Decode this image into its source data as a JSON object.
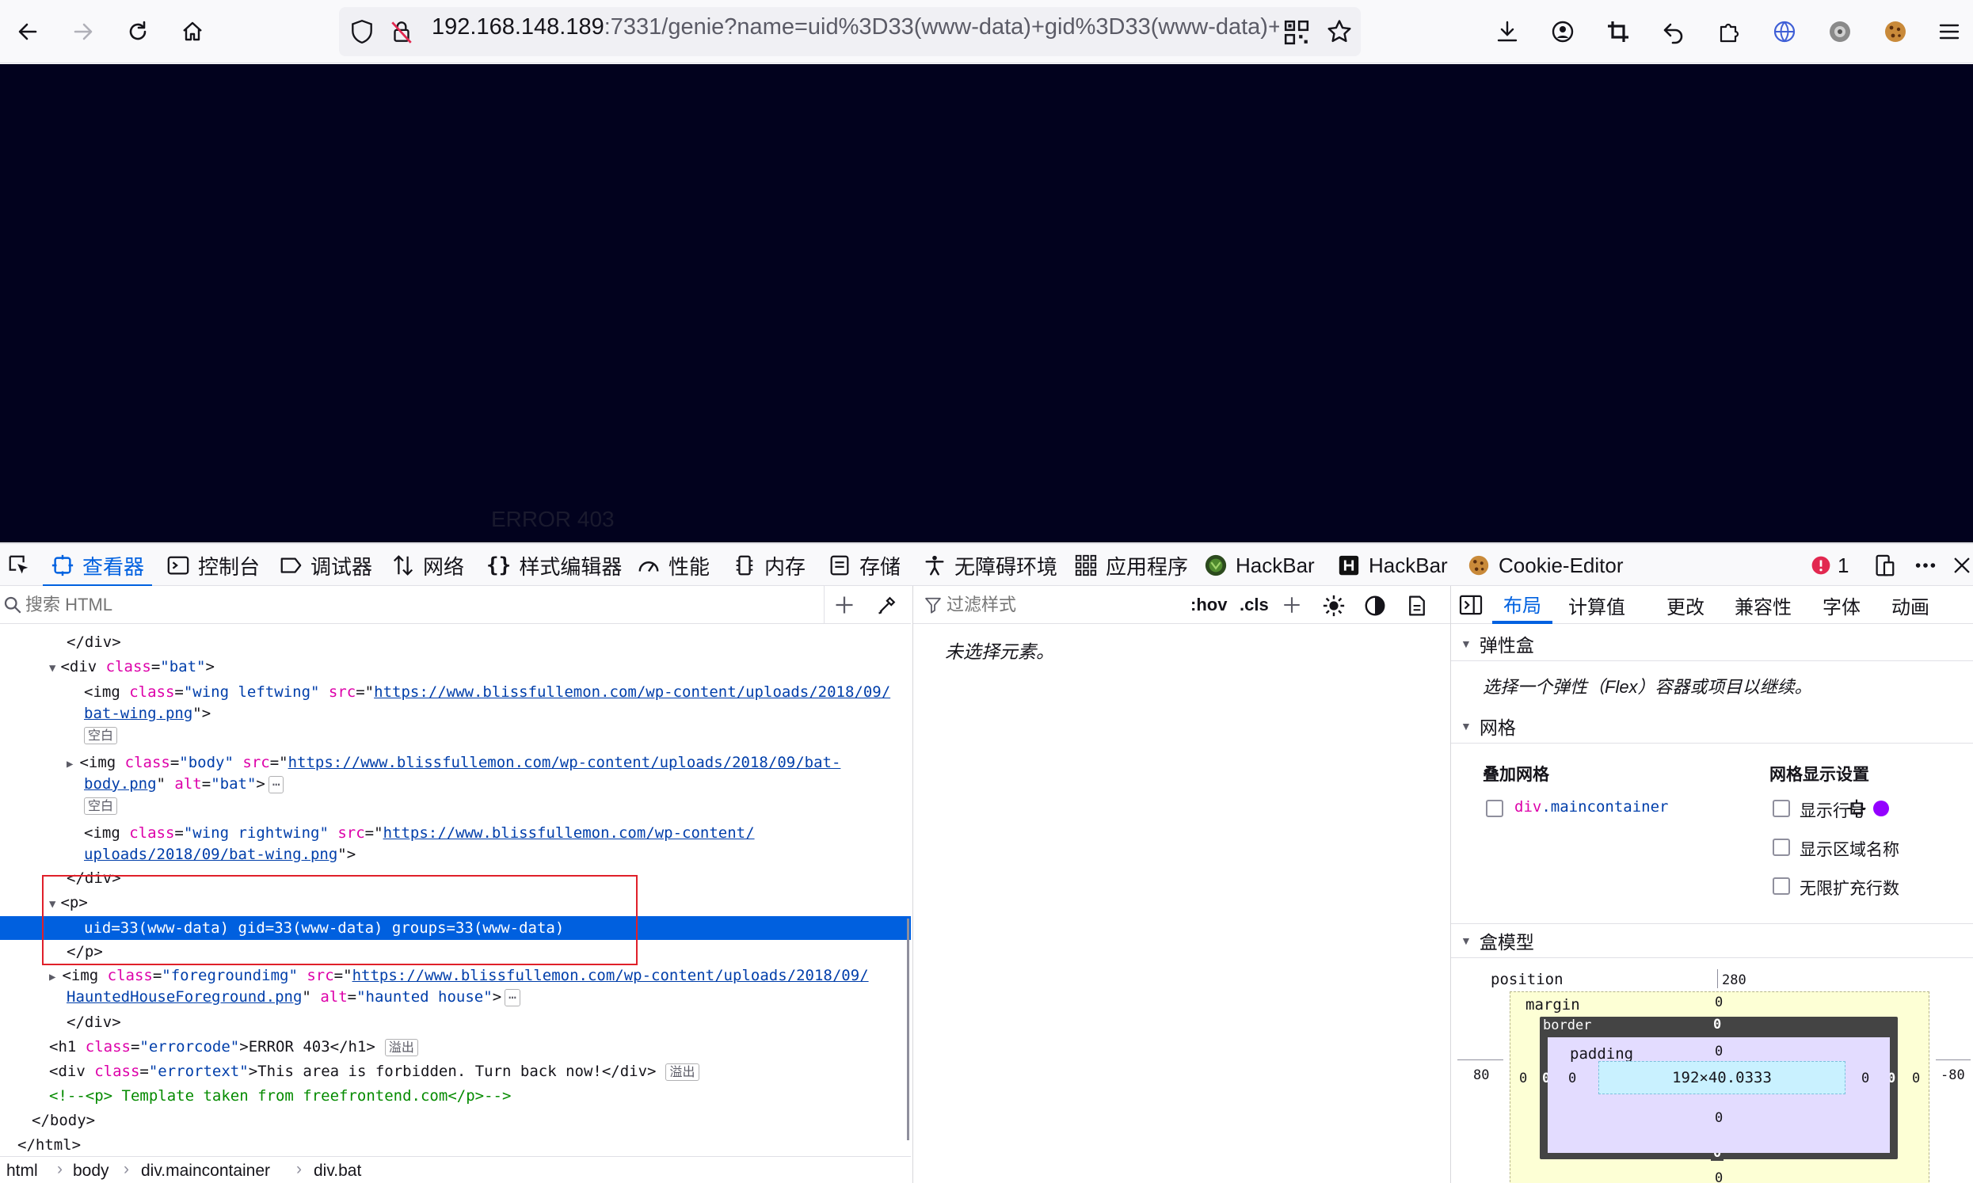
{
  "browser": {
    "url_host": "192.168.148.189",
    "url_rest": ":7331/genie?name=uid%3D33(www-data)+gid%3D33(www-data)+"
  },
  "page": {
    "ghost_text": "ERROR 403"
  },
  "devtools": {
    "tabs": [
      {
        "label": "查看器",
        "icon": "inspector-icon"
      },
      {
        "label": "控制台",
        "icon": "console-icon"
      },
      {
        "label": "调试器",
        "icon": "debugger-icon"
      },
      {
        "label": "网络",
        "icon": "network-icon"
      },
      {
        "label": "样式编辑器",
        "icon": "style-editor-icon"
      },
      {
        "label": "性能",
        "icon": "performance-icon"
      },
      {
        "label": "内存",
        "icon": "memory-icon"
      },
      {
        "label": "存储",
        "icon": "storage-icon"
      },
      {
        "label": "无障碍环境",
        "icon": "accessibility-icon"
      },
      {
        "label": "应用程序",
        "icon": "application-icon"
      },
      {
        "label": "HackBar",
        "icon": "hackbar-icon"
      },
      {
        "label": "HackBar",
        "icon": "hackbar-h-icon"
      },
      {
        "label": "Cookie-Editor",
        "icon": "cookie-icon"
      }
    ],
    "error_count": "1",
    "search_placeholder": "搜索 HTML",
    "markup": {
      "l_div_close": "</div>",
      "l_bat_open_pre": "<div ",
      "l_bat_class_attr": "class",
      "l_bat_class_val": "\"bat\"",
      "l_img_tag": "<img ",
      "l_class": "class",
      "l_src": "src",
      "l_alt": "alt",
      "l_wing_left_class": "\"wing leftwing\"",
      "l_wing_left_src1": "https://www.blissfullemon.com/wp-content/uploads/2018/09/",
      "l_wing_left_src2": "bat-wing.png",
      "whitespace_badge": "空白",
      "l_body_class": "\"body\"",
      "l_body_src1": "https://www.blissfullemon.com/wp-content/uploads/2018/09/bat-",
      "l_body_src2": "body.png",
      "l_body_alt": "\"bat\"",
      "ellipsis": "⋯",
      "l_wing_right_class": "\"wing rightwing\"",
      "l_wing_right_src1": "https://www.blissfullemon.com/wp-content/",
      "l_wing_right_src2": "uploads/2018/09/bat-wing.png",
      "l_p_open": "<p>",
      "l_p_text": "uid=33(www-data) gid=33(www-data) groups=33(www-data)",
      "l_p_close": "</p>",
      "l_fg_class": "\"foregroundimg\"",
      "l_fg_src1": "https://www.blissfullemon.com/wp-content/uploads/2018/09/",
      "l_fg_src2": "HauntedHouseForeground.png",
      "l_fg_alt": "\"haunted house\"",
      "l_h1_pre": "<h1 ",
      "l_h1_class": "\"errorcode\"",
      "l_h1_text": "ERROR 403",
      "l_h1_close": "</h1>",
      "overflow_badge": "溢出",
      "l_div_open": "<div ",
      "l_et_class": "\"errortext\"",
      "l_et_text": "This area is forbidden. Turn back now!",
      "l_comment": "<!--<p> Template taken from freefrontend.com</p>-->",
      "l_body_close": "</body>",
      "l_html_close": "</html>"
    },
    "breadcrumbs": [
      "html",
      "body",
      "div.maincontainer",
      "div.bat"
    ],
    "rules": {
      "filter_placeholder": "过滤样式",
      "hov": ":hov",
      "cls": ".cls",
      "empty": "未选择元素。"
    },
    "layout": {
      "tabs": [
        "布局",
        "计算值",
        "更改",
        "兼容性",
        "字体",
        "动画"
      ],
      "flex_title": "弹性盒",
      "flex_desc": "选择一个弹性（Flex）容器或项目以继续。",
      "grid_title": "网格",
      "overlay_grid": "叠加网格",
      "grid_settings": "网格显示设置",
      "grid_item_tag": "div",
      "grid_item_class": ".maincontainer",
      "grid_item_color": "#9400ff",
      "grid_opts": [
        "显示行号",
        "显示区域名称",
        "无限扩充行数"
      ],
      "boxmodel_title": "盒模型",
      "position_label": "position",
      "position_top": "280",
      "position_left": "80",
      "position_right": "-80",
      "margin_label": "margin",
      "margin_top": "0",
      "margin_left": "0",
      "margin_right": "0",
      "border_label": "border",
      "border_top": "0",
      "border_left": "0",
      "border_right": "0",
      "border_bottom": "0",
      "padding_label": "padding",
      "padding_top": "0",
      "padding_left": "0",
      "padding_right": "0",
      "padding_bottom": "0",
      "content_size": "192×40.0333",
      "margin_bottom": "0"
    }
  }
}
